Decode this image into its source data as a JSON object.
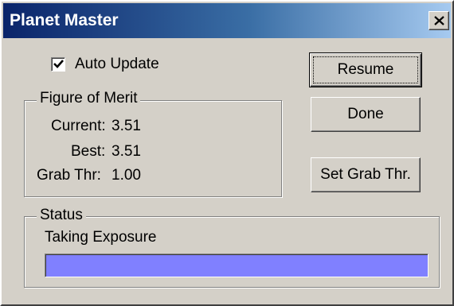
{
  "window": {
    "title": "Planet Master"
  },
  "auto_update": {
    "label": "Auto Update",
    "checked": true
  },
  "figure_of_merit": {
    "legend": "Figure of Merit",
    "rows": [
      {
        "label": "Current:",
        "value": "3.51"
      },
      {
        "label": "Best:",
        "value": "3.51"
      },
      {
        "label": "Grab Thr:",
        "value": "1.00"
      }
    ]
  },
  "buttons": {
    "resume": "Resume",
    "done": "Done",
    "set_grab_thr": "Set Grab Thr."
  },
  "status": {
    "legend": "Status",
    "text": "Taking Exposure",
    "progress_fraction": 1.0,
    "progress_color": "#8080ff"
  },
  "icons": {
    "close": "close-icon",
    "check": "checkmark-icon"
  }
}
